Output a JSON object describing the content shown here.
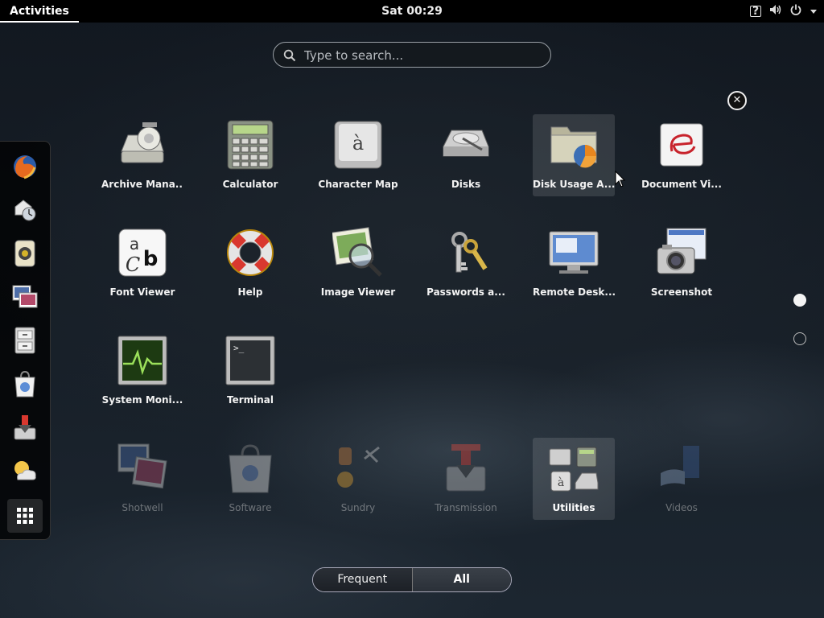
{
  "topbar": {
    "activities": "Activities",
    "clock": "Sat 00:29",
    "icons": [
      "help-icon",
      "volume-icon",
      "power-icon",
      "chevron-down-icon"
    ]
  },
  "search": {
    "placeholder": "Type to search..."
  },
  "dash": [
    "Firefox",
    "Evolution",
    "Rhythmbox",
    "Shotwell",
    "Files",
    "Software",
    "Transmission",
    "Weather",
    "Show Applications"
  ],
  "apps": [
    {
      "label": "Archive Mana...",
      "icon": "archive-manager-icon"
    },
    {
      "label": "Calculator",
      "icon": "calculator-icon"
    },
    {
      "label": "Character Map",
      "icon": "character-map-icon",
      "glyph": "à"
    },
    {
      "label": "Disks",
      "icon": "disks-icon"
    },
    {
      "label": "Disk Usage A...",
      "icon": "disk-usage-icon",
      "state": "hover"
    },
    {
      "label": "Document Vi...",
      "icon": "document-viewer-icon"
    },
    {
      "label": "Font Viewer",
      "icon": "font-viewer-icon",
      "glyph_a": "a",
      "glyph_c": "C",
      "glyph_b": "b"
    },
    {
      "label": "Help",
      "icon": "help-lifebuoy-icon"
    },
    {
      "label": "Image Viewer",
      "icon": "image-viewer-icon"
    },
    {
      "label": "Passwords a...",
      "icon": "passwords-keys-icon"
    },
    {
      "label": "Remote Desk...",
      "icon": "remote-desktop-icon"
    },
    {
      "label": "Screenshot",
      "icon": "screenshot-icon"
    },
    {
      "label": "System Moni...",
      "icon": "system-monitor-icon"
    },
    {
      "label": "Terminal",
      "icon": "terminal-icon",
      "prompt": ">_"
    }
  ],
  "folders": [
    {
      "label": "Shotwell",
      "icon": "shotwell-icon"
    },
    {
      "label": "Software",
      "icon": "software-icon"
    },
    {
      "label": "Sundry",
      "icon": "sundry-folder-icon"
    },
    {
      "label": "Transmission",
      "icon": "transmission-icon"
    },
    {
      "label": "Utilities",
      "icon": "utilities-folder-icon",
      "state": "selected",
      "glyph": "à"
    },
    {
      "label": "Videos",
      "icon": "videos-icon"
    }
  ],
  "tabs": {
    "frequent": "Frequent",
    "all": "All",
    "active": "All"
  },
  "pages": {
    "current": 1,
    "total": 2
  }
}
